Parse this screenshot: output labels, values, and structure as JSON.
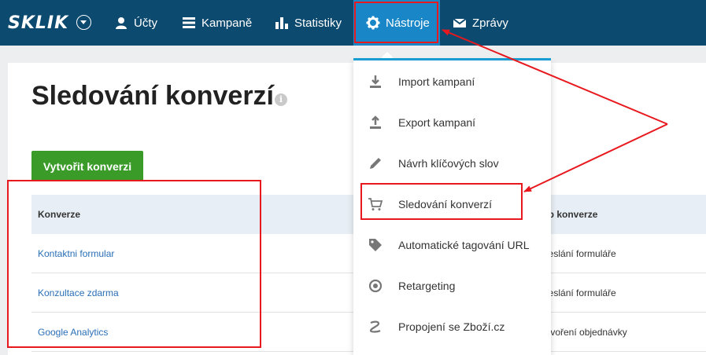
{
  "navbar": {
    "logo": "SKLIK",
    "items": [
      {
        "label": "Účty",
        "icon": "user-icon"
      },
      {
        "label": "Kampaně",
        "icon": "list-icon"
      },
      {
        "label": "Statistiky",
        "icon": "bar-chart-icon"
      },
      {
        "label": "Nástroje",
        "icon": "gear-icon",
        "active": true
      },
      {
        "label": "Zprávy",
        "icon": "mail-icon"
      }
    ]
  },
  "page": {
    "title": "Sledování konverzí",
    "create_button": "Vytvořit konverzi"
  },
  "table": {
    "headers": [
      "Konverze",
      "yp konverze"
    ],
    "rows": [
      {
        "name": "Kontaktni formular",
        "type": "deslání formuláře"
      },
      {
        "name": "Konzultace zdarma",
        "type": "deslání formuláře"
      },
      {
        "name": "Google Analytics",
        "type": "ytvoření objednávky"
      }
    ]
  },
  "dropdown": {
    "items": [
      {
        "label": "Import kampaní",
        "icon": "download-icon"
      },
      {
        "label": "Export kampaní",
        "icon": "upload-icon"
      },
      {
        "label": "Návrh klíčových slov",
        "icon": "pencil-icon"
      },
      {
        "label": "Sledování konverzí",
        "icon": "cart-icon"
      },
      {
        "label": "Automatické tagování URL",
        "icon": "tag-icon"
      },
      {
        "label": "Retargeting",
        "icon": "target-icon"
      },
      {
        "label": "Propojení se Zboží.cz",
        "icon": "zbozi-icon"
      }
    ]
  },
  "colors": {
    "navbar": "#0d4a6f",
    "active_nav": "#1987c7",
    "button_green": "#3a9b28",
    "link": "#2a6fb6",
    "annotation_red": "#e8191e"
  }
}
